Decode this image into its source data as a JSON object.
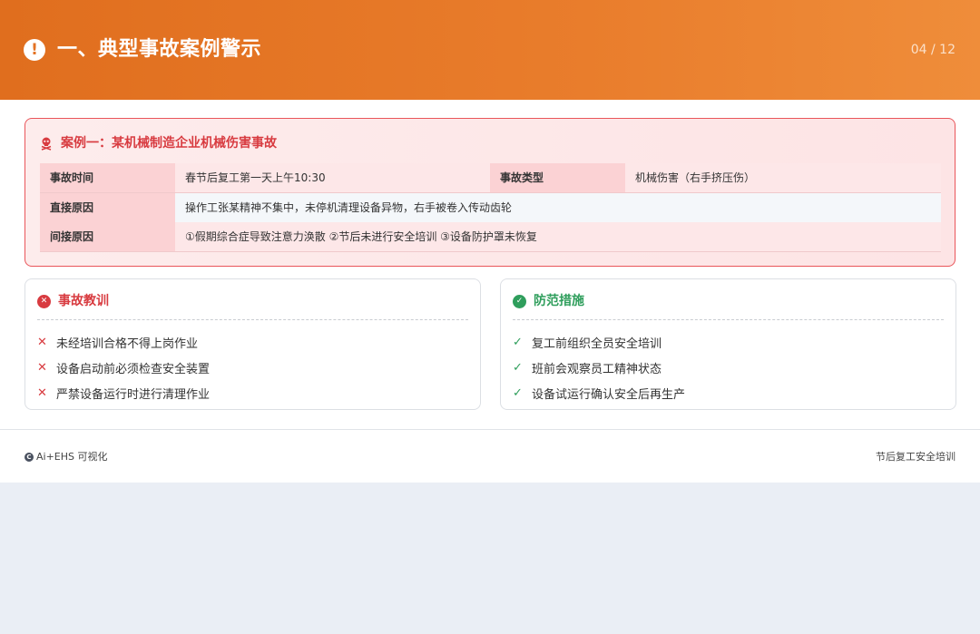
{
  "header": {
    "icon": "exclamation-icon",
    "title": "一、典型事故案例警示",
    "page_indicator": "04 / 12",
    "colors": {
      "gradient_start": "#e06e1e",
      "gradient_end": "#ef8d3a"
    }
  },
  "case": {
    "icon": "skull-icon",
    "title": "案例一：某机械制造企业机械伤害事故",
    "accent_color": "#d83b40",
    "rows": {
      "time_label": "事故时间",
      "time_value": "春节后复工第一天上午10:30",
      "type_label": "事故类型",
      "type_value": "机械伤害（右手挤压伤）",
      "direct_label": "直接原因",
      "direct_value": "操作工张某精神不集中，未停机清理设备异物，右手被卷入传动齿轮",
      "indirect_label": "间接原因",
      "indirect_value": "①假期综合症导致注意力涣散 ②节后未进行安全培训 ③设备防护罩未恢复"
    }
  },
  "lessons": {
    "icon": "x-circle-icon",
    "title": "事故教训",
    "color": "#d83b40",
    "items": [
      "未经培训合格不得上岗作业",
      "设备启动前必须检查安全装置",
      "严禁设备运行时进行清理作业"
    ]
  },
  "measures": {
    "icon": "check-circle-icon",
    "title": "防范措施",
    "color": "#2f9e5c",
    "items": [
      "复工前组织全员安全培训",
      "班前会观察员工精神状态",
      "设备试运行确认安全后再生产"
    ]
  },
  "footer": {
    "brand_icon": "copyright-icon",
    "brand": "Ai+EHS 可视化",
    "course": "节后复工安全培训"
  }
}
